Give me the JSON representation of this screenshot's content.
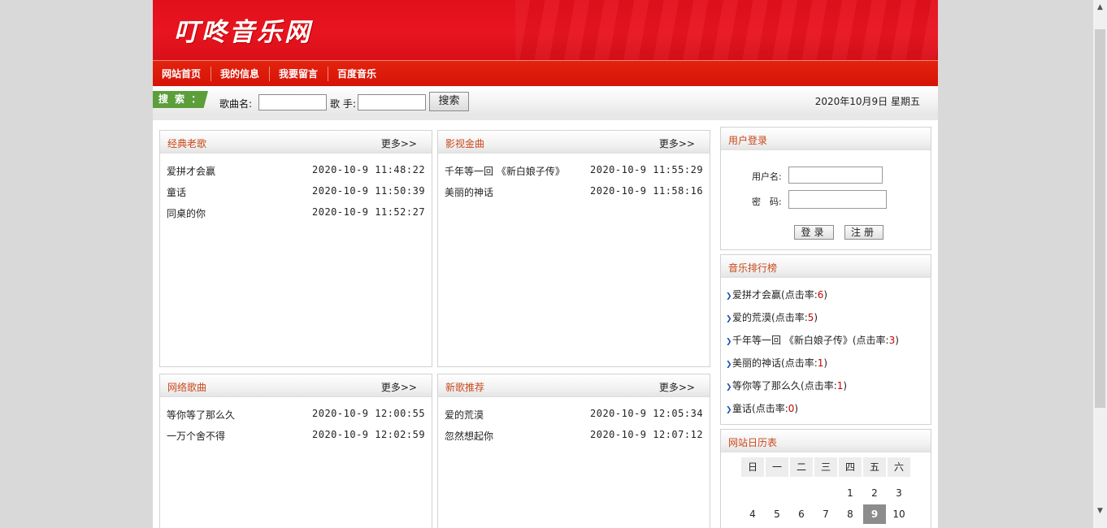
{
  "site": {
    "logo_text": "叮咚音乐网"
  },
  "nav": {
    "items": [
      "网站首页",
      "我的信息",
      "我要留言",
      "百度音乐"
    ]
  },
  "search": {
    "tag": "搜 索 ：",
    "song_label": "歌曲名:",
    "singer_label": "歌 手:",
    "song_value": "",
    "singer_value": "",
    "button": "搜索",
    "date": "2020年10月9日 星期五"
  },
  "boxes": [
    {
      "title": "经典老歌",
      "more": "更多>>",
      "songs": [
        {
          "name": "爱拼才会赢",
          "time": "2020-10-9 11:48:22"
        },
        {
          "name": "童话",
          "time": "2020-10-9 11:50:39"
        },
        {
          "name": "同桌的你",
          "time": "2020-10-9 11:52:27"
        }
      ]
    },
    {
      "title": "影视金曲",
      "more": "更多>>",
      "songs": [
        {
          "name": "千年等一回 《新白娘子传》",
          "time": "2020-10-9 11:55:29"
        },
        {
          "name": "美丽的神话",
          "time": "2020-10-9 11:58:16"
        }
      ]
    },
    {
      "title": "网络歌曲",
      "more": "更多>>",
      "songs": [
        {
          "name": "等你等了那么久",
          "time": "2020-10-9 12:00:55"
        },
        {
          "name": "一万个舍不得",
          "time": "2020-10-9 12:02:59"
        }
      ]
    },
    {
      "title": "新歌推荐",
      "more": "更多>>",
      "songs": [
        {
          "name": "爱的荒漠",
          "time": "2020-10-9 12:05:34"
        },
        {
          "name": "忽然想起你",
          "time": "2020-10-9 12:07:12"
        }
      ]
    }
  ],
  "login": {
    "title": "用户登录",
    "username_label": "用户名:",
    "password_label": "密　码:",
    "login_button": "登录",
    "register_button": "注册"
  },
  "ranking": {
    "title": "音乐排行榜",
    "prefix": "(点击率:",
    "suffix": ")",
    "items": [
      {
        "name": "爱拼才会赢",
        "clicks": "6"
      },
      {
        "name": "爱的荒漠",
        "clicks": "5"
      },
      {
        "name": "千年等一回 《新白娘子传》",
        "clicks": "3"
      },
      {
        "name": "美丽的神话",
        "clicks": "1"
      },
      {
        "name": "等你等了那么久",
        "clicks": "1"
      },
      {
        "name": "童话",
        "clicks": "0"
      }
    ]
  },
  "calendar": {
    "title": "网站日历表",
    "weekdays": [
      "日",
      "一",
      "二",
      "三",
      "四",
      "五",
      "六"
    ],
    "week1": [
      "",
      "",
      "",
      "",
      "1",
      "2",
      "3"
    ],
    "week2": [
      "4",
      "5",
      "6",
      "7",
      "8",
      "9",
      "10"
    ],
    "today": "9"
  },
  "colors": {
    "brand_red": "#e2101c",
    "title_orange": "#c9481a",
    "search_green": "#5b9e3a"
  }
}
